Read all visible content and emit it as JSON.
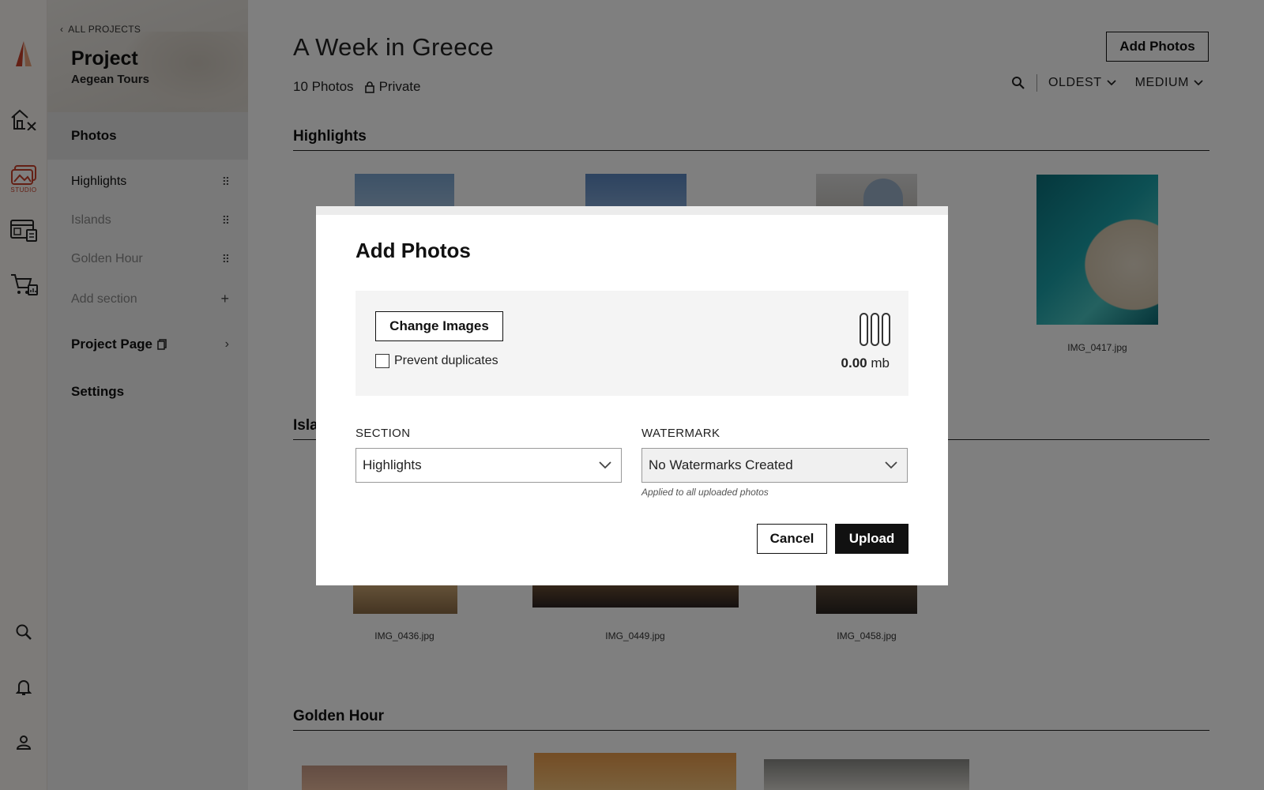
{
  "rail": {
    "studio_label": "STUDIO"
  },
  "sidebar": {
    "back_label": "ALL PROJECTS",
    "project_title": "Project",
    "project_subtitle": "Aegean Tours",
    "photos_label": "Photos",
    "sections": [
      {
        "label": "Highlights"
      },
      {
        "label": "Islands"
      },
      {
        "label": "Golden Hour"
      }
    ],
    "add_section_label": "Add section",
    "project_page_label": "Project Page",
    "settings_label": "Settings"
  },
  "main": {
    "title": "A Week in Greece",
    "photo_count": "10 Photos",
    "privacy": "Private",
    "add_photos_label": "Add Photos",
    "sort_label": "OLDEST",
    "size_label": "MEDIUM",
    "sections": [
      {
        "title": "Highlights"
      },
      {
        "title": "Islands"
      },
      {
        "title": "Golden Hour"
      }
    ],
    "captions": {
      "img_0417": "IMG_0417.jpg",
      "img_0436": "IMG_0436.jpg",
      "img_0449": "IMG_0449.jpg",
      "img_0458": "IMG_0458.jpg"
    }
  },
  "modal": {
    "title": "Add Photos",
    "change_images_label": "Change Images",
    "prevent_duplicates_label": "Prevent duplicates",
    "prevent_duplicates_checked": false,
    "size_value": "0.00",
    "size_unit": "mb",
    "section_label": "SECTION",
    "section_value": "Highlights",
    "watermark_label": "WATERMARK",
    "watermark_value": "No Watermarks Created",
    "watermark_hint": "Applied to all uploaded photos",
    "cancel_label": "Cancel",
    "upload_label": "Upload"
  },
  "colors": {
    "accent": "#c8402a",
    "overlay": "rgba(0,0,0,0.5)"
  }
}
